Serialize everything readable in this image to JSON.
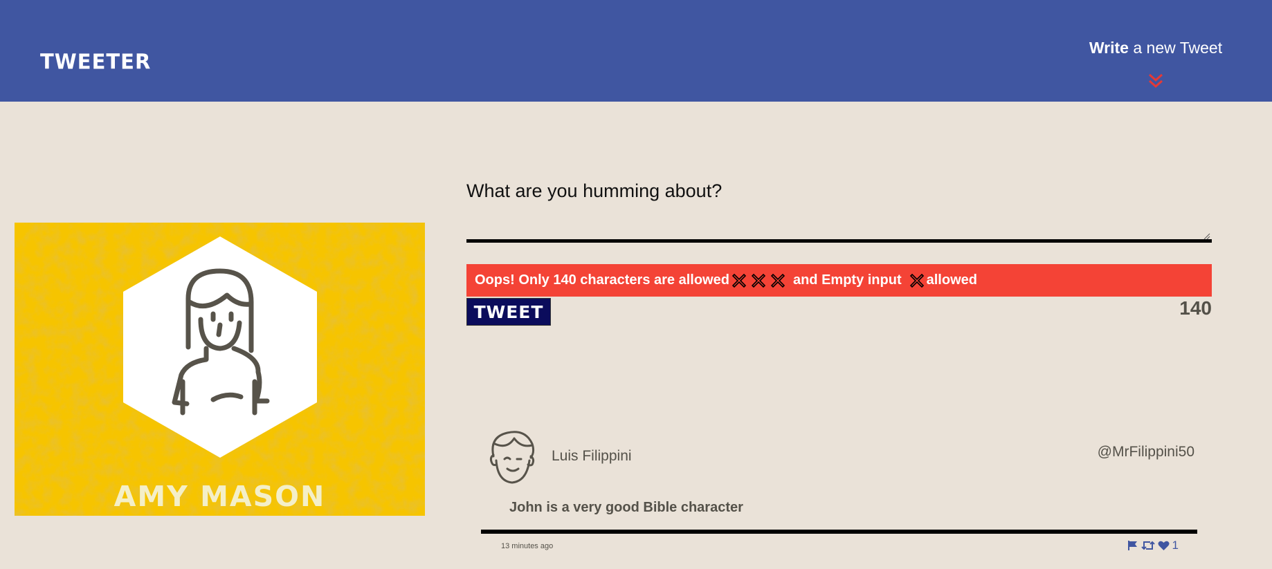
{
  "nav": {
    "brand": "TWEETER",
    "write_bold": "Write",
    "write_rest": " a new Tweet"
  },
  "profile": {
    "name": "AMY MASON"
  },
  "compose": {
    "prompt": "What are you humming about?",
    "input_value": "",
    "error_part1": "Oops! Only 140 characters are allowed",
    "error_part2": "and Empty input",
    "error_part3": "allowed",
    "button_label": "TWEET",
    "counter": "140"
  },
  "tweet": {
    "author": "Luis Filippini",
    "handle": "@MrFilippini50",
    "content": "John is a very good Bible character",
    "time": "13 minutes ago",
    "like_count": "1"
  },
  "colors": {
    "nav_bg": "#4056a1",
    "page_bg": "#eae2d8",
    "error_bg": "#f44336",
    "tweet_button_bg": "#0b0c5c",
    "chevron": "#e53935",
    "profile_bg": "#f6c400"
  },
  "icons": [
    "double-chevron-down-icon",
    "user-avatar-icon",
    "x-icon",
    "flag-icon",
    "retweet-icon",
    "heart-icon"
  ]
}
